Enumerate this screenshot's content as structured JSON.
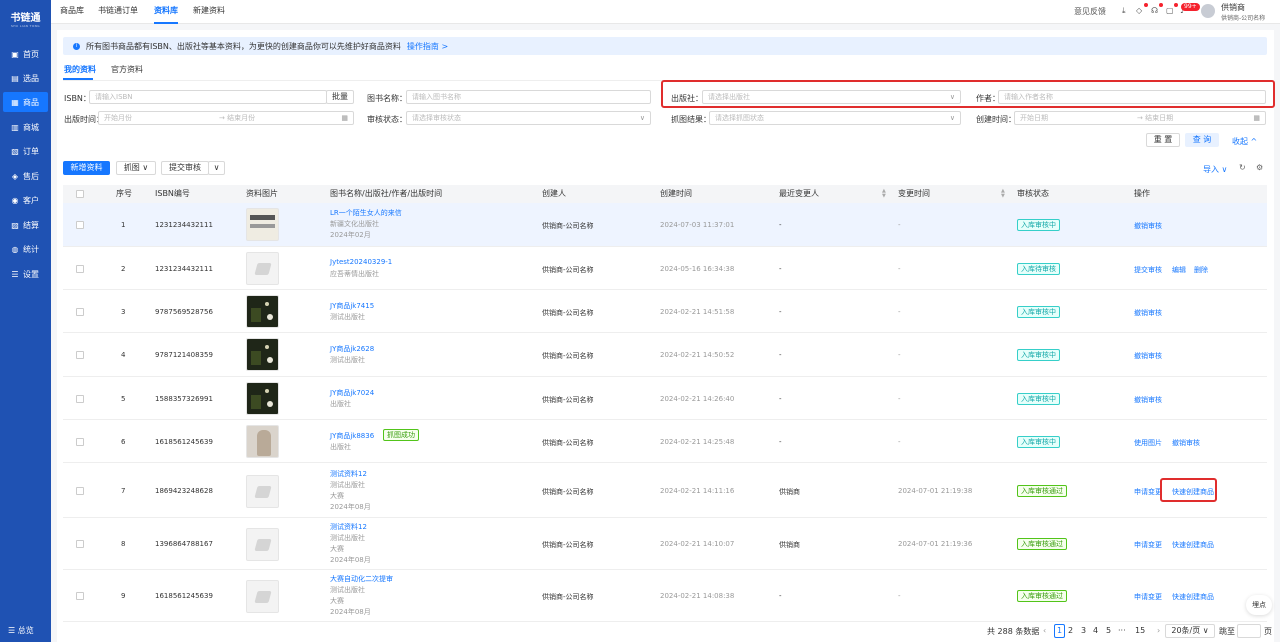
{
  "brand": {
    "name": "书链通",
    "sub": "SHU LIAN TONG"
  },
  "sidebar": [
    {
      "icon": "▣",
      "label": "首页"
    },
    {
      "icon": "▤",
      "label": "选品"
    },
    {
      "icon": "▦",
      "label": "商品"
    },
    {
      "icon": "▥",
      "label": "商城"
    },
    {
      "icon": "▧",
      "label": "订单"
    },
    {
      "icon": "◈",
      "label": "售后"
    },
    {
      "icon": "◉",
      "label": "客户"
    },
    {
      "icon": "▨",
      "label": "结算"
    },
    {
      "icon": "◍",
      "label": "统计"
    },
    {
      "icon": "☰",
      "label": "设置"
    }
  ],
  "sidebar_total": "总览",
  "top_tabs": [
    "商品库",
    "书链通订单",
    "资料库",
    "新建资料"
  ],
  "header": {
    "feedback": "意见反馈",
    "badge": "99+",
    "user": "供销商",
    "company": "供销商-公司名称"
  },
  "notice": {
    "text": "所有图书商品都有ISBN、出版社等基本资料，为更快的创建商品你可以先维护好商品资料",
    "link": "操作指南 >"
  },
  "sub_tabs": [
    "我的资料",
    "官方资料"
  ],
  "filters": {
    "isbn_label": "ISBN：",
    "isbn_ph": "请输入ISBN",
    "batch": "批量",
    "name_label": "图书名称：",
    "name_ph": "请输入图书名称",
    "publisher_label": "出版社：",
    "publisher_ph": "请选择出版社",
    "author_label": "作者：",
    "author_ph": "请输入作者名称",
    "pubtime_label": "出版时间：",
    "pubtime_start": "开始月份",
    "pubtime_end": "结束月份",
    "audit_label": "审核状态：",
    "audit_ph": "请选择审核状态",
    "grab_label": "抓图结果：",
    "grab_ph": "请选择抓图状态",
    "created_label": "创建时间：",
    "created_start": "开始日期",
    "created_end": "结束日期",
    "reset": "重 置",
    "query": "查 询",
    "collapse": "收起 ^"
  },
  "toolbar": {
    "new": "新增资料",
    "grab": "抓图 ∨",
    "submit": "提交审核",
    "more": "∨",
    "import": "导入 ∨"
  },
  "columns": [
    "序号",
    "ISBN编号",
    "资料图片",
    "图书名称/出版社/作者/出版时间",
    "创建人",
    "创建时间",
    "最近变更人",
    "变更时间",
    "审核状态",
    "操作"
  ],
  "rows": [
    {
      "no": "1",
      "isbn": "1231234432111",
      "img": "book",
      "title": "LR一个陌生女人的来信",
      "sub": [
        "新疆文化出版社",
        "2024年02月"
      ],
      "tag": "",
      "creator": "供销商-公司名称",
      "ctime": "2024-07-03 11:37:01",
      "changer": "-",
      "mtime": "-",
      "status": "入库审核中",
      "st": "",
      "ops": [
        "撤销审核"
      ]
    },
    {
      "no": "2",
      "isbn": "1231234432111",
      "img": "ph",
      "title": "Jytest20240329-1",
      "sub": [
        "应吾蒂情出版社"
      ],
      "tag": "",
      "creator": "供销商-公司名称",
      "ctime": "2024-05-16 16:34:38",
      "changer": "-",
      "mtime": "-",
      "status": "入库待审核",
      "st": "",
      "ops": [
        "提交审核",
        "编辑",
        "删除"
      ]
    },
    {
      "no": "3",
      "isbn": "9787569528756",
      "img": "dark",
      "title": "JY商品jk7415",
      "sub": [
        "测试出版社"
      ],
      "tag": "",
      "creator": "供销商-公司名称",
      "ctime": "2024-02-21 14:51:58",
      "changer": "-",
      "mtime": "-",
      "status": "入库审核中",
      "st": "",
      "ops": [
        "撤销审核"
      ]
    },
    {
      "no": "4",
      "isbn": "9787121408359",
      "img": "dark",
      "title": "JY商品jk2628",
      "sub": [
        "测试出版社"
      ],
      "tag": "",
      "creator": "供销商-公司名称",
      "ctime": "2024-02-21 14:50:52",
      "changer": "-",
      "mtime": "-",
      "status": "入库审核中",
      "st": "",
      "ops": [
        "撤销审核"
      ]
    },
    {
      "no": "5",
      "isbn": "1588357326991",
      "img": "dark",
      "title": "JY商品jk7024",
      "sub": [
        "出版社"
      ],
      "tag": "",
      "creator": "供销商-公司名称",
      "ctime": "2024-02-21 14:26:40",
      "changer": "-",
      "mtime": "-",
      "status": "入库审核中",
      "st": "",
      "ops": [
        "撤销审核"
      ]
    },
    {
      "no": "6",
      "isbn": "1618561245639",
      "img": "person",
      "title": "JY商品jk8836",
      "sub": [
        "出版社"
      ],
      "tag": "抓图成功",
      "creator": "供销商-公司名称",
      "ctime": "2024-02-21 14:25:48",
      "changer": "-",
      "mtime": "-",
      "status": "入库审核中",
      "st": "",
      "ops": [
        "使用图片",
        "撤销审核"
      ]
    },
    {
      "no": "7",
      "isbn": "1869423248628",
      "img": "ph",
      "title": "测试资料12",
      "sub": [
        "测试出版社",
        "大赛",
        "2024年08月"
      ],
      "tag": "",
      "creator": "供销商-公司名称",
      "ctime": "2024-02-21 14:11:16",
      "changer": "供销商",
      "mtime": "2024-07-01 21:19:38",
      "status": "入库审核通过",
      "st": "ok",
      "ops": [
        "申请变更",
        "快速创建商品"
      ]
    },
    {
      "no": "8",
      "isbn": "1396864788167",
      "img": "ph",
      "title": "测试资料12",
      "sub": [
        "测试出版社",
        "大赛",
        "2024年08月"
      ],
      "tag": "",
      "creator": "供销商-公司名称",
      "ctime": "2024-02-21 14:10:07",
      "changer": "供销商",
      "mtime": "2024-07-01 21:19:36",
      "status": "入库审核通过",
      "st": "ok",
      "ops": [
        "申请变更",
        "快速创建商品"
      ]
    },
    {
      "no": "9",
      "isbn": "1618561245639",
      "img": "ph",
      "title": "大赛自动化二次提审",
      "sub": [
        "测试出版社",
        "大赛",
        "2024年08月"
      ],
      "tag": "",
      "creator": "供销商-公司名称",
      "ctime": "2024-02-21 14:08:38",
      "changer": "-",
      "mtime": "-",
      "status": "入库审核通过",
      "st": "ok",
      "ops": [
        "申请变更",
        "快速创建商品"
      ]
    }
  ],
  "pagination": {
    "total": "共 288 条数据",
    "pages": [
      "1",
      "2",
      "3",
      "4",
      "5",
      "···",
      "15"
    ],
    "size": "20条/页 ∨",
    "jump": "跳至",
    "page": "页"
  },
  "float_label": "埋点"
}
